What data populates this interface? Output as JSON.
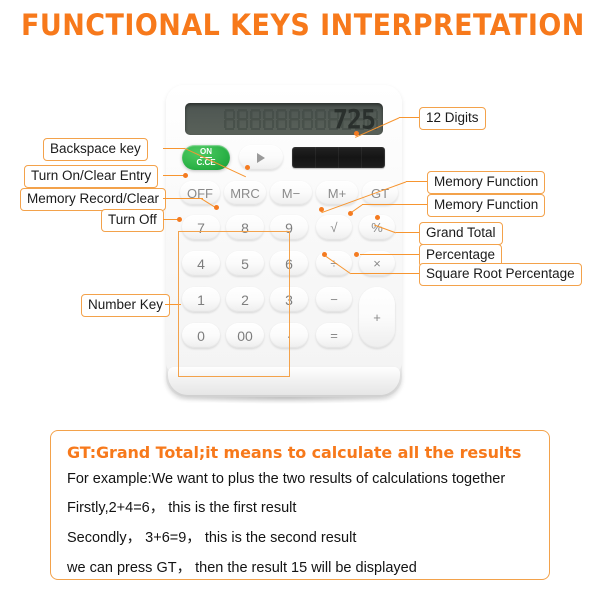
{
  "header": {
    "title": "FUNCTIONAL KEYS INTERPRETATION",
    "title_color": "#F7791B"
  },
  "theme": {
    "accent_orange": "#F7791B",
    "callout_border": "#F3A24B",
    "leader_line": "#F7952F",
    "dot": "#F47B20",
    "key_text": "#8a8a8a",
    "on_button_green": "#2fb54a",
    "lcd_background": "#525a55",
    "solar_panel": "#1a1a1a"
  },
  "calculator": {
    "display": {
      "value": "725",
      "digit_capacity": "12"
    },
    "solar_panel_label": "solar-panel",
    "keys": {
      "backspace": "▶",
      "on_clear_entry_top": "ON",
      "on_clear_entry_bottom": "C.CE",
      "function_row": [
        "OFF",
        "MRC",
        "M−",
        "M+",
        "GT"
      ],
      "row_1": [
        "7",
        "8",
        "9",
        "√",
        "%"
      ],
      "row_2": [
        "4",
        "5",
        "6",
        "÷",
        "×"
      ],
      "row_3": [
        "1",
        "2",
        "3",
        "−",
        "+"
      ],
      "row_4": [
        "0",
        "00",
        "·",
        "="
      ]
    }
  },
  "callouts": {
    "left": [
      {
        "label": "Backspace key"
      },
      {
        "label": "Turn On/Clear Entry"
      },
      {
        "label": "Memory Record/Clear"
      },
      {
        "label": "Turn Off"
      },
      {
        "label": "Number Key"
      }
    ],
    "right": [
      {
        "label": "12 Digits"
      },
      {
        "label": "Memory Function"
      },
      {
        "label": "Memory Function"
      },
      {
        "label": "Grand Total"
      },
      {
        "label": "Percentage"
      },
      {
        "label": "Square Root Percentage"
      }
    ]
  },
  "note": {
    "heading": "GT:Grand Total;it means to calculate all the results",
    "lines": [
      "For example:We want to plus the two  results of calculations together",
      "Firstly,2+4=6， this is the first result",
      "Secondly， 3+6=9， this is the second result",
      "we can press GT， then the result 15 will be displayed"
    ]
  }
}
